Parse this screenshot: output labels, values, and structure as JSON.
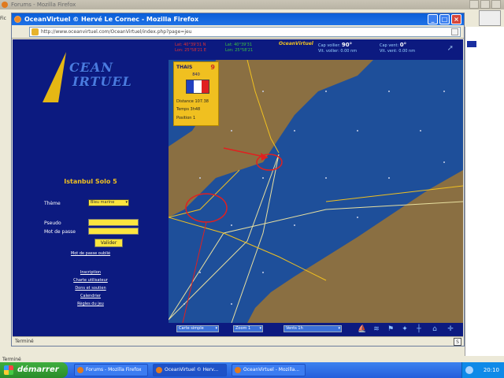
{
  "background_window": {
    "title": "Forums - Mozilla Firefox",
    "left_letters": "Fic",
    "status": "Terminé"
  },
  "browser": {
    "title": "OceanVirtuel © Hervé Le Cornec - Mozilla Firefox",
    "url": "http://www.oceanvirtuel.com/OceanVirtuel/index.php?page=jeu"
  },
  "sidebar": {
    "logo_line1": "CEAN",
    "logo_line2": "IRTUEL",
    "race_title": "Istanbul Solo 5",
    "theme_label": "Thème",
    "theme_value": "Bleu marine",
    "login_label": "Pseudo",
    "password_label": "Mot de passe",
    "validate_label": "Valider",
    "forgot_label": "Mot de passe oublié",
    "links": [
      "Inscription",
      "Charte utilisateur",
      "Dons et soutien",
      "Calendrier",
      "Règles du jeu"
    ]
  },
  "map_header": {
    "pos_red_1": "Lat: 40°39'31 N",
    "pos_red_2": "Lon: 25°58'21 E",
    "pos_green_1": "Lat: 40°39'31",
    "pos_green_2": "Lon: 25°58'21",
    "logo_text": "OceanVirtuel",
    "cap_label": "Cap voilier:",
    "cap_value": "90°",
    "speed_label": "Vit. voilier:",
    "speed_value": "0.00 nm",
    "wind_label": "Cap vent:",
    "wind_value": "0°",
    "wind_speed_label": "Vit. vent:",
    "wind_speed_value": "0.00 nm"
  },
  "boat_card": {
    "name": "THAIS",
    "number": "9",
    "code": "840",
    "line1": "Distance 107.38",
    "line2": "Temps 3h48",
    "line3": "Position 1",
    "flag_colors": [
      "#2040c0",
      "#ffffff",
      "#e02020"
    ]
  },
  "map_footer": {
    "select1": "Carte simple",
    "select2": "Zoom 1",
    "select3": "Vents 1h",
    "tools": [
      "boat-icon",
      "wind-icon",
      "barb-icon",
      "compass-icon",
      "mark-icon",
      "home-icon",
      "cross-icon"
    ]
  },
  "page_status": {
    "text": "Terminé",
    "badge": "S"
  },
  "taskbar": {
    "start_label": "démarrer",
    "tasks": [
      {
        "label": "Forums - Mozilla Firefox"
      },
      {
        "label": "OceanVirtuel © Herv..."
      },
      {
        "label": "OceanVirtuel - Mozilla..."
      }
    ],
    "time": "20:10"
  },
  "colors": {
    "page_bg": "#0c1a80",
    "accent_yellow": "#f0c020",
    "sea": "#1e4f9a",
    "land": "#8a6f42"
  }
}
